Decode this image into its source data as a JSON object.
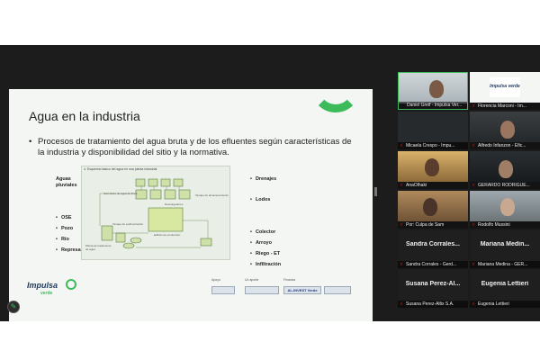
{
  "slide": {
    "title": "Agua en la industria",
    "bullet": "Procesos de tratamiento del agua bruta y de los efluentes según características de la industria y disponibilidad del sitio y la normativa.",
    "left_header": "Aguas pluviales",
    "sources": [
      "OSE",
      "Pozo",
      "Río",
      "Represa"
    ],
    "right_top": [
      "Drenajes",
      "Lodos"
    ],
    "destinations": [
      "Colector",
      "Arroyo",
      "Riego - ET",
      "Infiltración"
    ],
    "diagram_caption": "4. Esquema básico del agua en una planta industrial",
    "diagram_labels": [
      "Suministro de agua de línea",
      "Tanque de almacenamiento",
      "Planta de tratamiento de agua",
      "Edificio de producción",
      "Tanque de sedimentación",
      "Descargadores"
    ],
    "footer_logo": "Impulsa",
    "footer_logo_sub": "verde",
    "sponsor_labels": [
      "Apoyo",
      "Un aporte",
      "Financia"
    ],
    "sponsor_box": "AL-INVEST Verde"
  },
  "gallery": {
    "tiles": [
      {
        "name": "Daniel Greif - Impulsa Ver...",
        "muted": false,
        "active": true
      },
      {
        "name": "Florencia Marconi - Im...",
        "muted": true,
        "logo": "Impulsa verde"
      },
      {
        "name": "Micaela Crespo - Impu...",
        "muted": true
      },
      {
        "name": "Alfredo Infanzon - Efic...",
        "muted": true
      },
      {
        "name": "AnaOlhaki",
        "muted": true
      },
      {
        "name": "GERARDO RODRIGUE...",
        "muted": true
      },
      {
        "name": "Por: Culpa de Sam",
        "muted": true
      },
      {
        "name": "Rodolfo Mussini",
        "muted": true
      },
      {
        "name": "Sandra Corrales - Gerd...",
        "big": "Sandra Corrales...",
        "muted": true
      },
      {
        "name": "Mariana Medina - GER...",
        "big": "Mariana Medin...",
        "muted": true
      },
      {
        "name": "Susana Perez-Altix S.A.",
        "big": "Susana Perez-Al...",
        "muted": true
      },
      {
        "name": "Eugenia Lettieri",
        "big": "Eugenia Lettieri",
        "muted": true
      }
    ]
  },
  "icons": {
    "mic_muted": "mic-muted-icon",
    "pencil": "pencil-icon"
  },
  "colors": {
    "accent": "#3dbb5a",
    "mute": "#e53935"
  }
}
